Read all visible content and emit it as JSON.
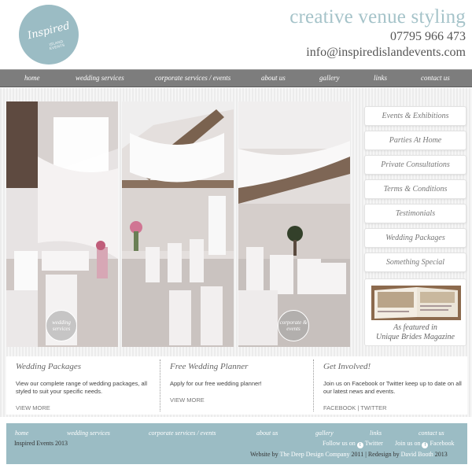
{
  "header": {
    "logo_script": "Inspired",
    "logo_sub": "ISLAND EVENTS",
    "tagline": "creative venue styling",
    "phone": "07795 966 473",
    "email": "info@inspiredislandevents.com"
  },
  "nav": {
    "items": [
      "home",
      "wedding services",
      "corporate services / events",
      "about us",
      "gallery",
      "links",
      "contact us"
    ]
  },
  "panels": {
    "badge_left": "wedding services",
    "badge_right": "corporate & events"
  },
  "sidebar": {
    "items": [
      "Events & Exhibitions",
      "Parties At Home",
      "Private Consultations",
      "Terms & Conditions",
      "Testimonials",
      "Wedding Packages",
      "Something Special"
    ],
    "magazine_caption_1": "As featured in",
    "magazine_caption_2": "Unique Brides Magazine"
  },
  "boxes": [
    {
      "title": "Wedding Packages",
      "text": "View our complete range of wedding packages, all styled to suit your specific needs.",
      "link": "VIEW MORE"
    },
    {
      "title": "Free Wedding Planner",
      "text": "Apply for our free wedding planner!",
      "link": "VIEW MORE"
    },
    {
      "title": "Get Involved!",
      "text": "Join us on Facebook or Twitter keep up to date on all our latest news and events.",
      "link": "FACEBOOK | TWITTER"
    }
  ],
  "footer": {
    "nav": [
      "home",
      "wedding services",
      "corporate services / events",
      "about us",
      "gallery",
      "links",
      "contact us"
    ],
    "copyright": "Inspired Events 2013",
    "follow_text": "Follow us on",
    "twitter": "Twitter",
    "join_text": "Join us on",
    "facebook": "Facebook",
    "credit_prefix": "Website by",
    "credit_company": "The Deep Design Company",
    "credit_year": "2011 | Redesign by",
    "credit_designer": "David Booth",
    "credit_year2": "2013"
  },
  "colors": {
    "accent": "#9bbcc4",
    "nav_bg": "#7d7d7d",
    "tagline": "#a5c3c9"
  }
}
